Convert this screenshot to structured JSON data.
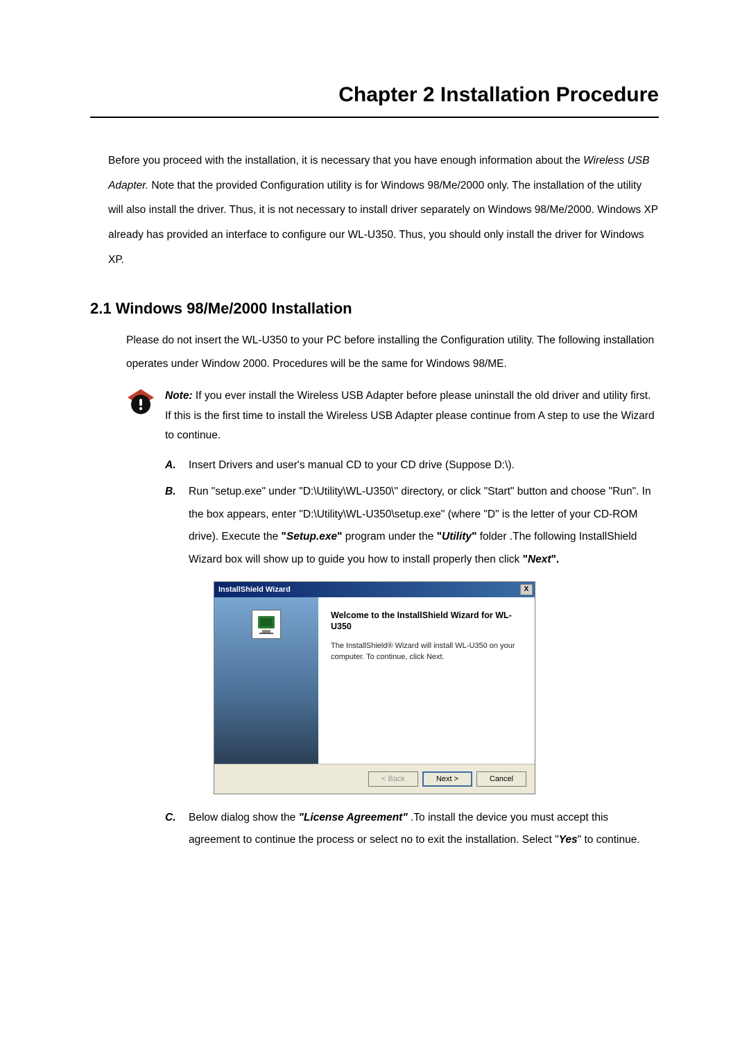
{
  "chapter_title": "Chapter 2 Installation Procedure",
  "intro": {
    "p1a": "Before you proceed with the installation, it is necessary that you have enough information about the ",
    "p1b_italic": "Wireless USB Adapter.",
    "p1c": "  Note that the provided Configuration utility is for Windows 98/Me/2000 only. The installation of the utility will also install the driver.  Thus, it is not necessary to install driver separately on Windows 98/Me/2000. Windows XP already has provided an interface to configure our WL-U350.  Thus, you should only install the driver for Windows XP."
  },
  "section_title": "2.1 Windows 98/Me/2000 Installation",
  "section_intro": "Please do not insert the WL-U350 to your PC before installing the Configuration utility.  The following installation operates under Window 2000.  Procedures will be the same for Windows 98/ME.",
  "note": {
    "label": "Note:",
    "text": " If you ever install the Wireless USB Adapter before please uninstall the old driver and utility first. If this is the first time to install the Wireless USB Adapter please continue from A step to use the Wizard to continue."
  },
  "steps": {
    "A": {
      "letter": "A.",
      "text": "Insert Drivers and user's manual CD to your CD drive (Suppose D:\\)."
    },
    "B": {
      "letter": "B.",
      "t1": "Run \"setup.exe\" under \"D:\\Utility\\WL-U350\\\" directory, or click \"Start\" button and choose \"Run\".  In the box appears, enter \"D:\\Utility\\WL-U350\\setup.exe\" (where \"D\" is the letter of your CD-ROM drive).  Execute the ",
      "t2_bold": "\"",
      "t2_bi": "Setup.exe",
      "t2_bold2": "\"",
      "t3": " program under the ",
      "t4_bold": "\"",
      "t4_bi": "Utility",
      "t4_bold2": "\"",
      "t5": " folder .The following InstallShield Wizard box will show up to guide you how to install properly then click ",
      "t6_bold": "\"",
      "t6_bi": "Next",
      "t6_bold2": "\"."
    },
    "C": {
      "letter": "C.",
      "t1": "Below dialog show the ",
      "t2_bi": "\"License Agreement\"",
      "t3": " .To install the device you must accept this agreement to continue the process or select no to exit the installation. Select \"",
      "t4_bi": "Yes",
      "t5": "\" to continue."
    }
  },
  "wizard": {
    "title": "InstallShield Wizard",
    "close": "X",
    "heading": "Welcome to the InstallShield Wizard for WL-U350",
    "desc": "The InstallShield® Wizard will install WL-U350 on your computer. To continue, click Next.",
    "back": "< Back",
    "next": "Next >",
    "cancel": "Cancel"
  }
}
